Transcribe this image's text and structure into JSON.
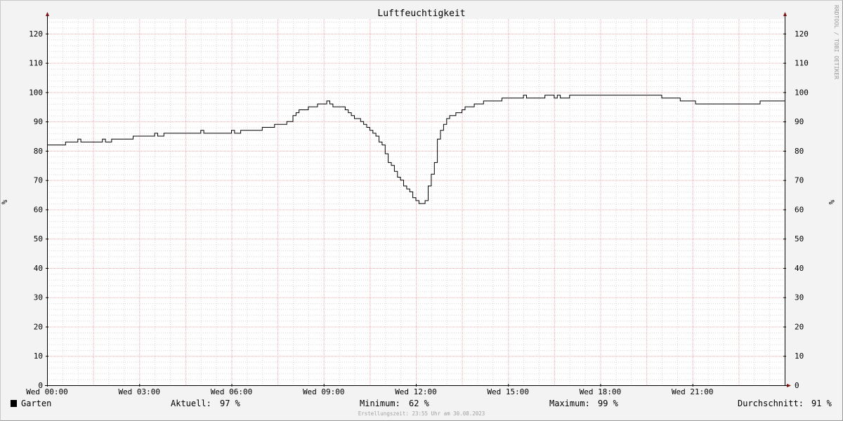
{
  "chart_data": {
    "type": "line",
    "title": "Luftfeuchtigkeit",
    "ylabel_left": "%",
    "ylabel_right": "%",
    "watermark": "RRDTOOL / TOBI OETIKER",
    "ylim": [
      0,
      125
    ],
    "yticks": [
      0,
      10,
      20,
      30,
      40,
      50,
      60,
      70,
      80,
      90,
      100,
      110,
      120
    ],
    "xlim": [
      0,
      24
    ],
    "xticks": [
      {
        "h": 0,
        "label": "Wed 00:00"
      },
      {
        "h": 3,
        "label": "Wed 03:00"
      },
      {
        "h": 6,
        "label": "Wed 06:00"
      },
      {
        "h": 9,
        "label": "Wed 09:00"
      },
      {
        "h": 12,
        "label": "Wed 12:00"
      },
      {
        "h": 15,
        "label": "Wed 15:00"
      },
      {
        "h": 18,
        "label": "Wed 18:00"
      },
      {
        "h": 21,
        "label": "Wed 21:00"
      }
    ],
    "x_unit": "hours",
    "grid": true,
    "series": [
      {
        "name": "Garten",
        "color": "#000000",
        "points": [
          [
            0.0,
            82
          ],
          [
            0.6,
            82
          ],
          [
            0.6,
            83
          ],
          [
            1.0,
            83
          ],
          [
            1.0,
            84
          ],
          [
            1.1,
            84
          ],
          [
            1.1,
            83
          ],
          [
            1.8,
            83
          ],
          [
            1.8,
            84
          ],
          [
            1.9,
            84
          ],
          [
            1.9,
            83
          ],
          [
            2.1,
            83
          ],
          [
            2.1,
            84
          ],
          [
            2.8,
            84
          ],
          [
            2.8,
            85
          ],
          [
            3.5,
            85
          ],
          [
            3.5,
            86
          ],
          [
            3.6,
            86
          ],
          [
            3.6,
            85
          ],
          [
            3.8,
            85
          ],
          [
            3.8,
            86
          ],
          [
            5.0,
            86
          ],
          [
            5.0,
            87
          ],
          [
            5.1,
            87
          ],
          [
            5.1,
            86
          ],
          [
            6.0,
            86
          ],
          [
            6.0,
            87
          ],
          [
            6.1,
            87
          ],
          [
            6.1,
            86
          ],
          [
            6.3,
            86
          ],
          [
            6.3,
            87
          ],
          [
            7.0,
            87
          ],
          [
            7.0,
            88
          ],
          [
            7.4,
            88
          ],
          [
            7.4,
            89
          ],
          [
            7.8,
            89
          ],
          [
            7.8,
            90
          ],
          [
            8.0,
            90
          ],
          [
            8.0,
            92
          ],
          [
            8.1,
            92
          ],
          [
            8.1,
            93
          ],
          [
            8.2,
            93
          ],
          [
            8.2,
            94
          ],
          [
            8.5,
            94
          ],
          [
            8.5,
            95
          ],
          [
            8.8,
            95
          ],
          [
            8.8,
            96
          ],
          [
            9.1,
            96
          ],
          [
            9.1,
            97
          ],
          [
            9.2,
            97
          ],
          [
            9.2,
            96
          ],
          [
            9.3,
            96
          ],
          [
            9.3,
            95
          ],
          [
            9.7,
            95
          ],
          [
            9.7,
            94
          ],
          [
            9.8,
            94
          ],
          [
            9.8,
            93
          ],
          [
            9.9,
            93
          ],
          [
            9.9,
            92
          ],
          [
            10.0,
            92
          ],
          [
            10.0,
            91
          ],
          [
            10.2,
            91
          ],
          [
            10.2,
            90
          ],
          [
            10.3,
            90
          ],
          [
            10.3,
            89
          ],
          [
            10.4,
            89
          ],
          [
            10.4,
            88
          ],
          [
            10.5,
            88
          ],
          [
            10.5,
            87
          ],
          [
            10.6,
            87
          ],
          [
            10.6,
            86
          ],
          [
            10.7,
            86
          ],
          [
            10.7,
            85
          ],
          [
            10.8,
            85
          ],
          [
            10.8,
            83
          ],
          [
            10.9,
            83
          ],
          [
            10.9,
            82
          ],
          [
            11.0,
            82
          ],
          [
            11.0,
            79
          ],
          [
            11.1,
            79
          ],
          [
            11.1,
            76
          ],
          [
            11.2,
            76
          ],
          [
            11.2,
            75
          ],
          [
            11.3,
            75
          ],
          [
            11.3,
            73
          ],
          [
            11.4,
            73
          ],
          [
            11.4,
            71
          ],
          [
            11.5,
            71
          ],
          [
            11.5,
            70
          ],
          [
            11.6,
            70
          ],
          [
            11.6,
            68
          ],
          [
            11.7,
            68
          ],
          [
            11.7,
            67
          ],
          [
            11.8,
            67
          ],
          [
            11.8,
            66
          ],
          [
            11.9,
            66
          ],
          [
            11.9,
            64
          ],
          [
            12.0,
            64
          ],
          [
            12.0,
            63
          ],
          [
            12.1,
            63
          ],
          [
            12.1,
            62
          ],
          [
            12.2,
            62
          ],
          [
            12.3,
            62
          ],
          [
            12.3,
            63
          ],
          [
            12.4,
            63
          ],
          [
            12.4,
            68
          ],
          [
            12.5,
            68
          ],
          [
            12.5,
            72
          ],
          [
            12.6,
            72
          ],
          [
            12.6,
            76
          ],
          [
            12.7,
            76
          ],
          [
            12.7,
            84
          ],
          [
            12.8,
            84
          ],
          [
            12.8,
            87
          ],
          [
            12.9,
            87
          ],
          [
            12.9,
            89
          ],
          [
            13.0,
            89
          ],
          [
            13.0,
            91
          ],
          [
            13.1,
            91
          ],
          [
            13.1,
            92
          ],
          [
            13.3,
            92
          ],
          [
            13.3,
            93
          ],
          [
            13.5,
            93
          ],
          [
            13.5,
            94
          ],
          [
            13.6,
            94
          ],
          [
            13.6,
            95
          ],
          [
            13.9,
            95
          ],
          [
            13.9,
            96
          ],
          [
            14.2,
            96
          ],
          [
            14.2,
            97
          ],
          [
            14.8,
            97
          ],
          [
            14.8,
            98
          ],
          [
            15.5,
            98
          ],
          [
            15.5,
            99
          ],
          [
            15.6,
            99
          ],
          [
            15.6,
            98
          ],
          [
            16.2,
            98
          ],
          [
            16.2,
            99
          ],
          [
            16.5,
            99
          ],
          [
            16.5,
            98
          ],
          [
            16.6,
            98
          ],
          [
            16.6,
            99
          ],
          [
            16.7,
            99
          ],
          [
            16.7,
            98
          ],
          [
            17.0,
            98
          ],
          [
            17.0,
            99
          ],
          [
            20.0,
            99
          ],
          [
            20.0,
            98
          ],
          [
            20.6,
            98
          ],
          [
            20.6,
            97
          ],
          [
            21.1,
            97
          ],
          [
            21.1,
            96
          ],
          [
            23.2,
            96
          ],
          [
            23.2,
            97
          ],
          [
            24.0,
            97
          ]
        ]
      }
    ]
  },
  "legend": {
    "series_name": "Garten",
    "current_label": "Aktuell:",
    "current_value": "97 %",
    "min_label": "Minimum:",
    "min_value": "62 %",
    "max_label": "Maximum:",
    "max_value": "99 %",
    "avg_label": "Durchschnitt:",
    "avg_value": "91 %"
  },
  "footer": {
    "timestamp": "Erstellungszeit: 23:55 Uhr am 30.08.2023"
  }
}
